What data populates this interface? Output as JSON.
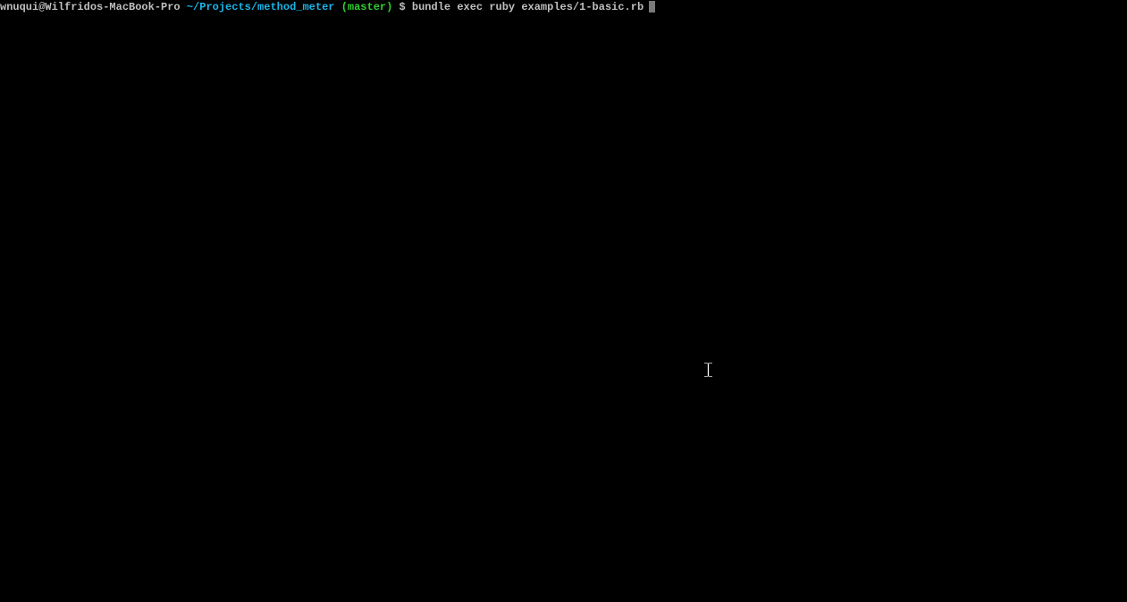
{
  "prompt": {
    "user_host": "wnuqui@Wilfridos-MacBook-Pro",
    "path": "~/Projects/method_meter",
    "branch": "(master)",
    "symbol": "$",
    "command": "bundle exec ruby examples/1-basic.rb"
  }
}
